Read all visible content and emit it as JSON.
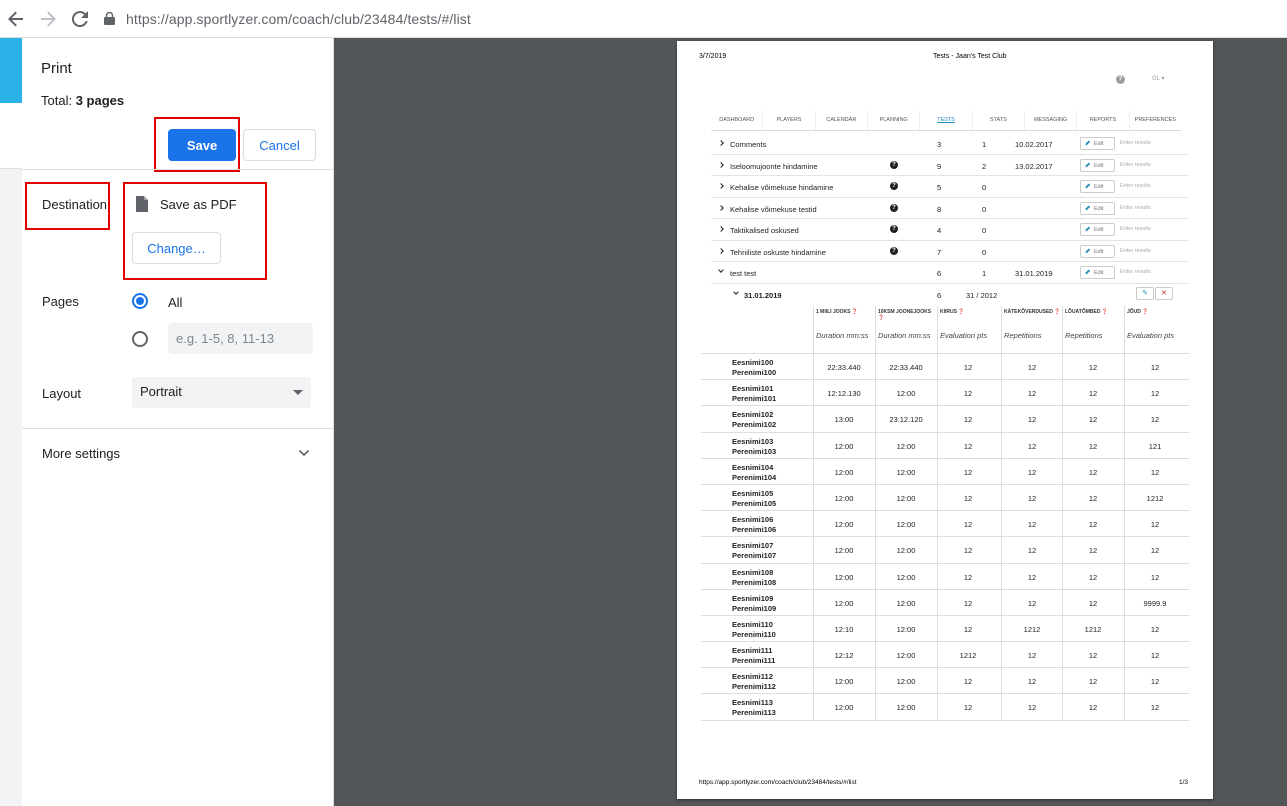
{
  "browser": {
    "url": "https://app.sportlyzer.com/coach/club/23484/tests/#/list"
  },
  "print": {
    "title": "Print",
    "total_label": "Total:",
    "total_value": "3 pages",
    "save_label": "Save",
    "cancel_label": "Cancel",
    "destination_label": "Destination",
    "destination_value": "Save as PDF",
    "change_label": "Change…",
    "pages_label": "Pages",
    "pages_all": "All",
    "pages_placeholder": "e.g. 1-5, 8, 11-13",
    "layout_label": "Layout",
    "layout_value": "Portrait",
    "more_settings": "More settings"
  },
  "doc": {
    "date": "3/7/2019",
    "title": "Tests - Jaan's Test Club",
    "lang": "GL",
    "help": "?",
    "nav": [
      "DASHBOARD",
      "PLAYERS",
      "CALENDAR",
      "PLANNING",
      "TESTS",
      "STATS",
      "MESSAGING",
      "REPORTS",
      "PREFERENCES"
    ],
    "edit_label": "Edit",
    "enter_label": "Enter results",
    "tests": [
      {
        "name": "Comments",
        "q": false,
        "c1": "3",
        "c2": "1",
        "c3": "10.02.2017",
        "open": false
      },
      {
        "name": "Iseloomujoonte hindamine",
        "q": true,
        "c1": "9",
        "c2": "2",
        "c3": "13.02.2017",
        "open": false
      },
      {
        "name": "Kehalise võimekuse hindamine",
        "q": true,
        "c1": "5",
        "c2": "0",
        "c3": "",
        "open": false
      },
      {
        "name": "Kehalise võimekuse testid",
        "q": true,
        "c1": "8",
        "c2": "0",
        "c3": "",
        "open": false
      },
      {
        "name": "Taktikalised oskused",
        "q": true,
        "c1": "4",
        "c2": "0",
        "c3": "",
        "open": false
      },
      {
        "name": "Tehniliste oskuste hindamine",
        "q": true,
        "c1": "7",
        "c2": "0",
        "c3": "",
        "open": false
      },
      {
        "name": "test test",
        "q": false,
        "c1": "6",
        "c2": "1",
        "c3": "31.01.2019",
        "open": true
      }
    ],
    "session": {
      "name": "31.01.2019",
      "c1": "6",
      "c2": "31 / 2012"
    },
    "columns": [
      {
        "head": "1 MIILI JOOKS ❓",
        "unit": "Duration mm:ss"
      },
      {
        "head": "10KSM JOONEJOOKS ❓",
        "unit": "Duration mm:ss"
      },
      {
        "head": "KIIRUS ❓",
        "unit": "Evaluation pts"
      },
      {
        "head": "KÄTEKÕVERDUSED ❓",
        "unit": "Repetitions"
      },
      {
        "head": "LÕUATÕMBED ❓",
        "unit": "Repetitions"
      },
      {
        "head": "JÕUD ❓",
        "unit": "Evaluation pts"
      }
    ],
    "athletes": [
      {
        "first": "Eesnimi100",
        "last": "Perenimi100",
        "vals": [
          "22:33.440",
          "22:33.440",
          "12",
          "12",
          "12",
          "12"
        ]
      },
      {
        "first": "Eesnimi101",
        "last": "Perenimi101",
        "vals": [
          "12:12.130",
          "12:00",
          "12",
          "12",
          "12",
          "12"
        ]
      },
      {
        "first": "Eesnimi102",
        "last": "Perenimi102",
        "vals": [
          "13:00",
          "23:12.120",
          "12",
          "12",
          "12",
          "12"
        ]
      },
      {
        "first": "Eesnimi103",
        "last": "Perenimi103",
        "vals": [
          "12:00",
          "12:00",
          "12",
          "12",
          "12",
          "121"
        ]
      },
      {
        "first": "Eesnimi104",
        "last": "Perenimi104",
        "vals": [
          "12:00",
          "12:00",
          "12",
          "12",
          "12",
          "12"
        ]
      },
      {
        "first": "Eesnimi105",
        "last": "Perenimi105",
        "vals": [
          "12:00",
          "12:00",
          "12",
          "12",
          "12",
          "1212"
        ]
      },
      {
        "first": "Eesnimi106",
        "last": "Perenimi106",
        "vals": [
          "12:00",
          "12:00",
          "12",
          "12",
          "12",
          "12"
        ]
      },
      {
        "first": "Eesnimi107",
        "last": "Perenimi107",
        "vals": [
          "12:00",
          "12:00",
          "12",
          "12",
          "12",
          "12"
        ]
      },
      {
        "first": "Eesnimi108",
        "last": "Perenimi108",
        "vals": [
          "12:00",
          "12:00",
          "12",
          "12",
          "12",
          "12"
        ]
      },
      {
        "first": "Eesnimi109",
        "last": "Perenimi109",
        "vals": [
          "12:00",
          "12:00",
          "12",
          "12",
          "12",
          "9999.9"
        ]
      },
      {
        "first": "Eesnimi110",
        "last": "Perenimi110",
        "vals": [
          "12:10",
          "12:00",
          "12",
          "1212",
          "1212",
          "12"
        ]
      },
      {
        "first": "Eesnimi111",
        "last": "Perenimi111",
        "vals": [
          "12:12",
          "12:00",
          "1212",
          "12",
          "12",
          "12"
        ]
      },
      {
        "first": "Eesnimi112",
        "last": "Perenimi112",
        "vals": [
          "12:00",
          "12:00",
          "12",
          "12",
          "12",
          "12"
        ]
      },
      {
        "first": "Eesnimi113",
        "last": "Perenimi113",
        "vals": [
          "12:00",
          "12:00",
          "12",
          "12",
          "12",
          "12"
        ]
      }
    ],
    "footer_url": "https://app.sportlyzer.com/coach/club/23484/tests/#/list",
    "footer_page": "1/3"
  },
  "colors": {
    "accent": "#1a73e8",
    "highlight": "#e00000",
    "preview_bg": "#525659"
  }
}
